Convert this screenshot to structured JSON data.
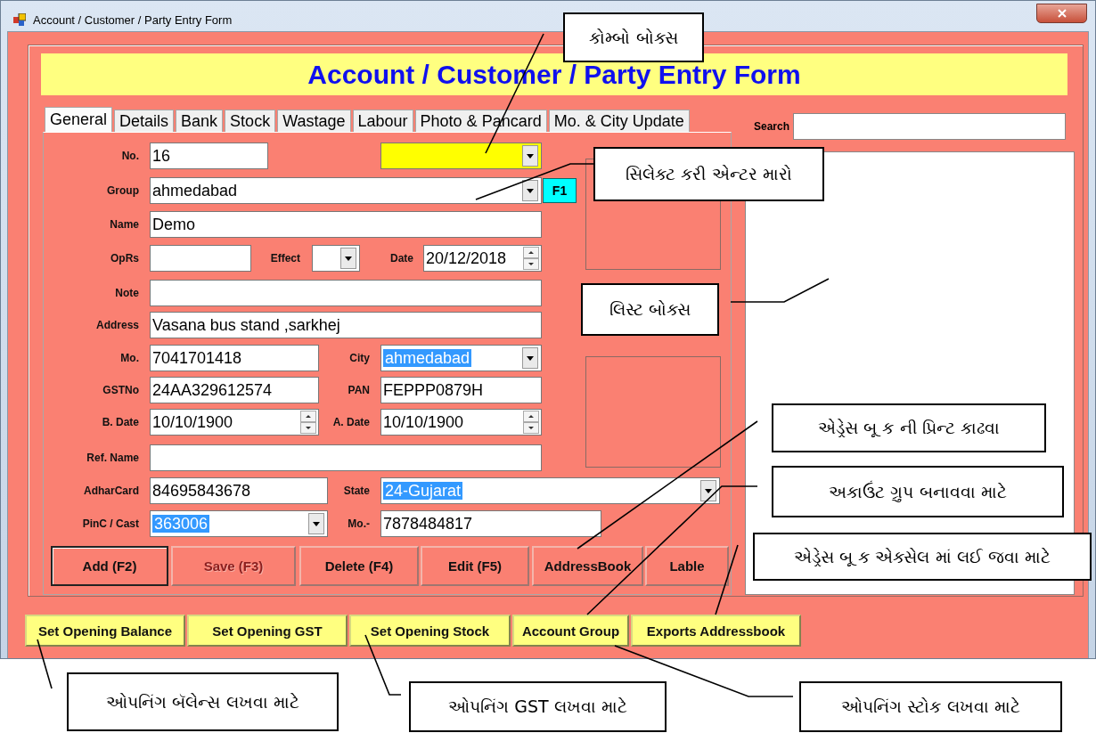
{
  "window": {
    "title": "Account / Customer / Party Entry Form"
  },
  "header": {
    "title": "Account / Customer / Party Entry Form"
  },
  "tabs": [
    {
      "label": "General",
      "selected": true
    },
    {
      "label": "Details",
      "selected": false
    },
    {
      "label": "Bank",
      "selected": false
    },
    {
      "label": "Stock",
      "selected": false
    },
    {
      "label": "Wastage",
      "selected": false
    },
    {
      "label": "Labour",
      "selected": false
    },
    {
      "label": "Photo & Pancard",
      "selected": false
    },
    {
      "label": "Mo. & City Update",
      "selected": false
    }
  ],
  "form_rows": [
    [
      {
        "label": "No.",
        "kind": "text",
        "value": "16"
      },
      {
        "kind": "combo",
        "emphasized": true
      }
    ],
    [
      {
        "label": "Group",
        "kind": "combo",
        "value": "ahmedabad",
        "emphasized": false
      },
      {
        "kind": "button",
        "caption": "F1"
      }
    ],
    [
      {
        "label": "Name",
        "kind": "text",
        "value": "Demo"
      }
    ],
    [
      {
        "label": "OpRs",
        "kind": "text"
      },
      {
        "label": "Effect",
        "kind": "combo",
        "emphasized": false
      },
      {
        "label": "Date",
        "kind": "date",
        "value": "20/12/2018"
      }
    ],
    [
      {
        "label": "Note",
        "kind": "text"
      }
    ],
    [
      {
        "label": "Address",
        "kind": "text",
        "value": "Vasana bus stand ,sarkhej"
      }
    ],
    [
      {
        "label": "Mo.",
        "kind": "text",
        "value": "7041701418"
      },
      {
        "label": "City",
        "kind": "combo",
        "value": "ahmedabad",
        "emphasized": false,
        "value_selected": true
      }
    ],
    [
      {
        "label": "GSTNo",
        "kind": "text",
        "value": "24AA329612574"
      },
      {
        "label": "PAN",
        "kind": "text",
        "value": "FEPPP0879H"
      }
    ],
    [
      {
        "label": "B. Date",
        "kind": "date",
        "value": "10/10/1900"
      },
      {
        "label": "A. Date",
        "kind": "date",
        "value": "10/10/1900"
      }
    ],
    [
      {
        "label": "Ref. Name",
        "kind": "text"
      }
    ],
    [
      {
        "label": "AdharCard",
        "kind": "text",
        "value": "84695843678"
      },
      {
        "label": "State",
        "kind": "combo",
        "value": "24-Gujarat",
        "emphasized": false,
        "value_selected": true
      }
    ],
    [
      {
        "label": "PinC / Cast",
        "kind": "combo",
        "value": "363006",
        "emphasized": false,
        "value_selected": true
      },
      {
        "label": "Mo.-",
        "kind": "text",
        "value": "7878484817"
      }
    ]
  ],
  "form_buttons": [
    {
      "label": "Add (F2)",
      "disabled": false,
      "default": true
    },
    {
      "label": "Save (F3)",
      "disabled": true,
      "default": false
    },
    {
      "label": "Delete (F4)",
      "disabled": false,
      "default": false
    },
    {
      "label": "Edit (F5)",
      "disabled": false,
      "default": false
    },
    {
      "label": "AddressBook",
      "disabled": false,
      "default": false
    },
    {
      "label": "Lable",
      "disabled": false,
      "default": false
    }
  ],
  "search": {
    "label": "Search"
  },
  "bottom_buttons": [
    "Set Opening Balance",
    "Set Opening GST",
    "Set Opening Stock",
    "Account Group",
    "Exports Addressbook"
  ],
  "callouts": [
    "કોમ્બો બોક્સ",
    "સિલેક્ટ કરી એન્ટર મારો",
    "લિસ્ટ બોક્સ",
    "એડ્રેસ બૂ ક ની પ્રિન્ટ કાઢવા",
    "અકાઉંટ ગ્રુપ બનાવવા માટે",
    "એડ્રેસ બૂ ક એક્સેલ માં લઈ જવા માટે",
    "ઓપનિંગ બૅલેન્સ લખવા માટે",
    "ઓપનિંગ GST લખવા માટે",
    "ઓપનિંગ સ્ટોક લખવા માટે"
  ]
}
